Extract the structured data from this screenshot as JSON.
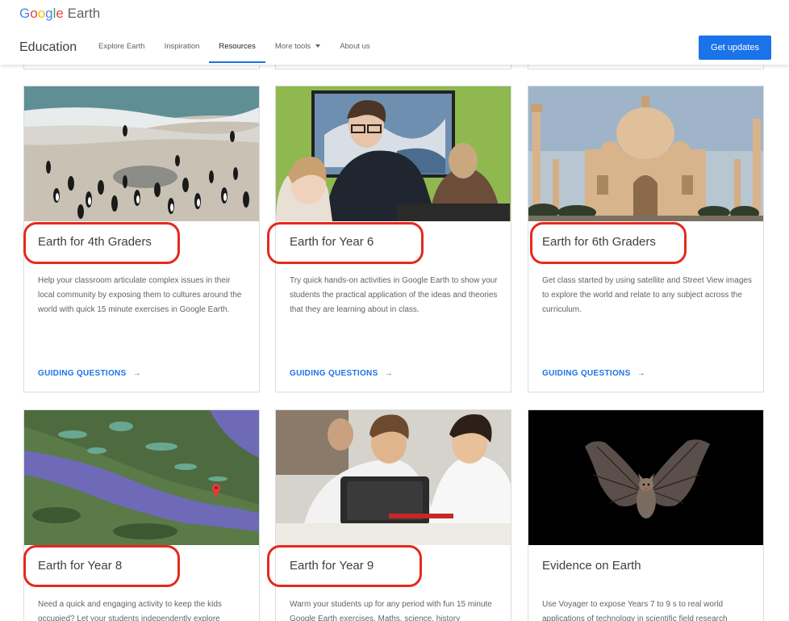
{
  "header": {
    "logo_letters": [
      "G",
      "o",
      "o",
      "g",
      "l",
      "e"
    ],
    "logo_product": "Earth",
    "section": "Education",
    "nav": [
      {
        "label": "Explore Earth",
        "active": false
      },
      {
        "label": "Inspiration",
        "active": false
      },
      {
        "label": "Resources",
        "active": true
      },
      {
        "label": "More tools",
        "active": false,
        "dropdown": true
      },
      {
        "label": "About us",
        "active": false
      }
    ],
    "cta_label": "Get updates"
  },
  "cards": [
    {
      "title": "Earth for 4th Graders",
      "highlighted": true,
      "description": "Help your classroom articulate complex issues in their local community by exposing them to cultures around the world with quick 15 minute exercises in Google Earth.",
      "link_label": "GUIDING QUESTIONS",
      "image": "penguins-beach"
    },
    {
      "title": "Earth for Year 6",
      "highlighted": true,
      "description": "Try quick hands-on activities in Google Earth to show your students the practical application of the ideas and theories that they are learning about in class.",
      "link_label": "GUIDING QUESTIONS",
      "image": "teacher-students"
    },
    {
      "title": "Earth for 6th Graders",
      "highlighted": true,
      "description": "Get class started by using satellite and Street View images to explore the world and relate to any subject across the curriculum.",
      "link_label": "GUIDING QUESTIONS",
      "image": "taj-mahal"
    },
    {
      "title": "Earth for Year 8",
      "highlighted": true,
      "description": "Need a quick and engaging activity to keep the kids occupied? Let your students independently explore",
      "link_label": "",
      "image": "satellite-map"
    },
    {
      "title": "Earth for Year 9",
      "highlighted": true,
      "description": "Warm your students up for any period with fun 15 minute Google Earth exercises. Maths, science, history",
      "link_label": "",
      "image": "students-tablet"
    },
    {
      "title": "Evidence on Earth",
      "highlighted": false,
      "description": "Use Voyager to expose Years 7 to 9 s to real world applications of technology in scientific field research",
      "link_label": "",
      "image": "bat"
    }
  ],
  "colors": {
    "accent": "#1a73e8",
    "highlight": "#e5291f"
  }
}
